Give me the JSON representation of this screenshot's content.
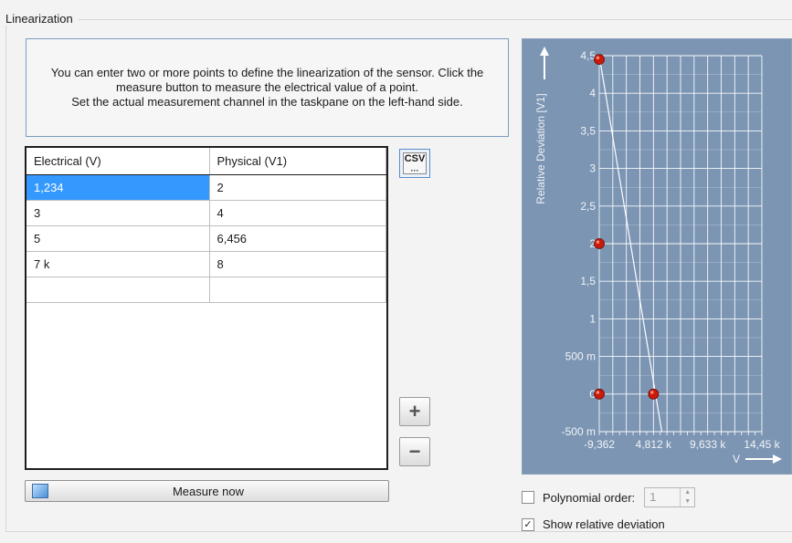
{
  "group": {
    "title": "Linearization"
  },
  "info": {
    "text": "You can enter two or more points to define the linearization of the sensor. Click the\nmeasure button to measure the electrical value of a point.\nSet the actual measurement channel in the taskpane on the left-hand side."
  },
  "table": {
    "columns": [
      "Electrical (V)",
      "Physical (V1)"
    ],
    "rows": [
      [
        "1,234",
        "2"
      ],
      [
        "3",
        "4"
      ],
      [
        "5",
        "6,456"
      ],
      [
        "7 k",
        "8"
      ],
      [
        "",
        ""
      ]
    ]
  },
  "buttons": {
    "csv_label": "CSV",
    "add_label": "+",
    "remove_label": "−",
    "measure_label": "Measure now"
  },
  "options": {
    "polynomial_label": "Polynomial order:",
    "polynomial_value": "1",
    "polynomial_checked": false,
    "show_dev_label": "Show relative deviation",
    "show_dev_checked": true,
    "check_glyph": "✓"
  },
  "chart_data": {
    "type": "scatter",
    "ylabel": "Relative Deviation [V1]",
    "xlabel": "V",
    "y_ticks": [
      "4,5",
      "4",
      "3,5",
      "3",
      "2,5",
      "2",
      "1,5",
      "1",
      "500 m",
      "0",
      "-500 m"
    ],
    "x_ticks": [
      "-9,362",
      "4,812 k",
      "9,633 k",
      "14,45 k"
    ],
    "ylim": [
      -0.5,
      4.5
    ],
    "xlim": [
      -9.362,
      14450
    ],
    "points": [
      {
        "x": -9.362,
        "y": 4.45
      },
      {
        "x": -9.362,
        "y": 2.0
      },
      {
        "x": -9.362,
        "y": 0.0
      },
      {
        "x": 4812,
        "y": 0.0
      }
    ],
    "line": [
      {
        "x": -9.362,
        "y": 4.5
      },
      {
        "x": 5550,
        "y": -0.5
      }
    ],
    "colors": {
      "background": "#7b95b3",
      "grid": "#ffffff",
      "point": "#cc1a0a"
    }
  }
}
